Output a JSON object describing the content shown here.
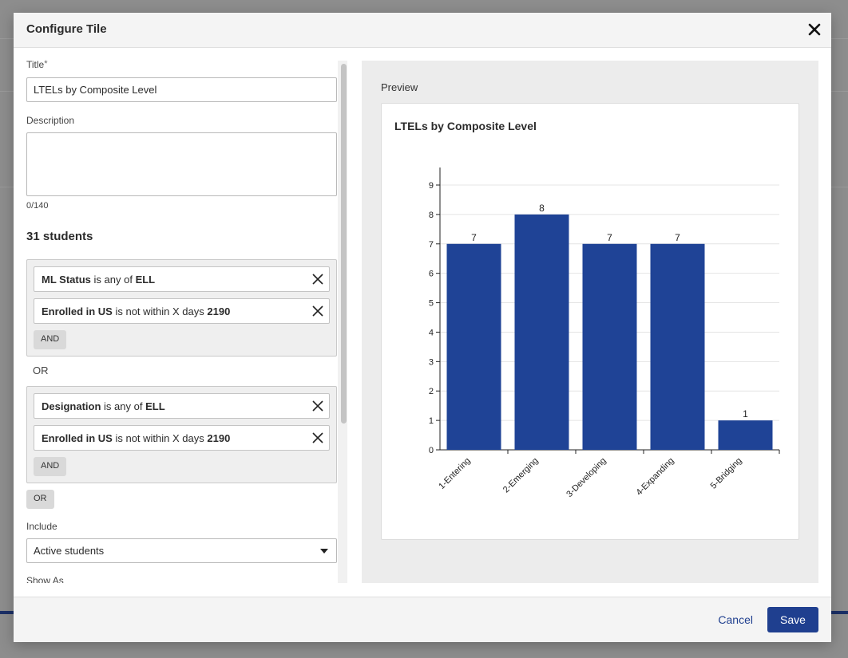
{
  "modal": {
    "title": "Configure Tile",
    "close_icon": "close-icon"
  },
  "form": {
    "title_label": "Title",
    "title_required_mark": "*",
    "title_value": "LTELs by Composite Level",
    "description_label": "Description",
    "description_value": "",
    "description_counter": "0/140",
    "student_count": "31 students",
    "groups": [
      {
        "filters": [
          {
            "field": "ML Status",
            "op": "is any of",
            "value": "ELL"
          },
          {
            "field": "Enrolled in US",
            "op": "is not within X days",
            "value": "2190"
          }
        ],
        "and_label": "AND"
      },
      {
        "filters": [
          {
            "field": "Designation",
            "op": "is any of",
            "value": "ELL"
          },
          {
            "field": "Enrolled in US",
            "op": "is not within X days",
            "value": "2190"
          }
        ],
        "and_label": "AND"
      }
    ],
    "or_separator": "OR",
    "or_button": "OR",
    "include_label": "Include",
    "include_value": "Active students",
    "show_as_label": "Show As"
  },
  "preview": {
    "label": "Preview",
    "chart_title": "LTELs by Composite Level"
  },
  "footer": {
    "cancel_label": "Cancel",
    "save_label": "Save"
  },
  "colors": {
    "bar": "#1f4396",
    "accent": "#1f3f8f"
  },
  "chart_data": {
    "type": "bar",
    "title": "LTELs by Composite Level",
    "categories": [
      "1-Entering",
      "2-Emerging",
      "3-Developing",
      "4-Expanding",
      "5-Bridging"
    ],
    "values": [
      7,
      8,
      7,
      7,
      1
    ],
    "xlabel": "",
    "ylabel": "",
    "ylim": [
      0,
      9
    ],
    "yticks": [
      0,
      1,
      2,
      3,
      4,
      5,
      6,
      7,
      8,
      9
    ],
    "grid": true,
    "data_labels": true
  }
}
